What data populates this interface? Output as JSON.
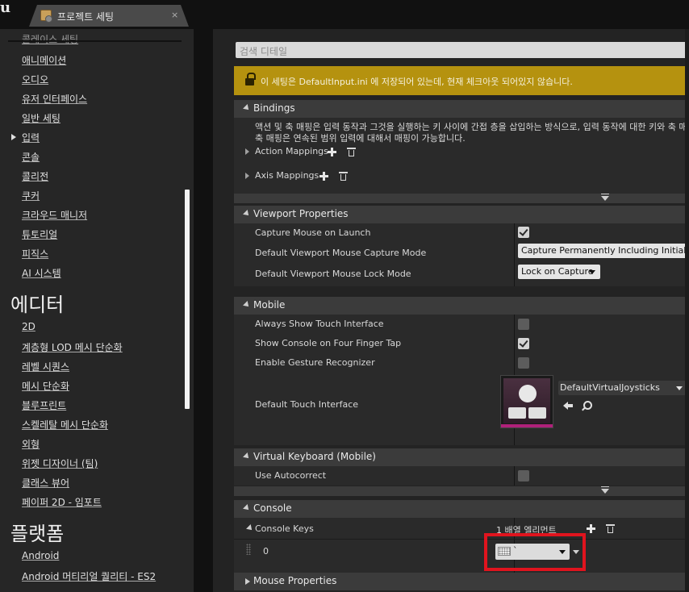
{
  "window": {
    "tab_title": "프로젝트 세팅",
    "close_glyph": "×",
    "logo_glyph": "u"
  },
  "sidebar": {
    "partial_top": "콜레이스 세팅",
    "items_engine": [
      {
        "label": "애니메이션"
      },
      {
        "label": "오디오"
      },
      {
        "label": "유저 인터페이스"
      },
      {
        "label": "일반 세팅"
      },
      {
        "label": "입력",
        "active": true
      },
      {
        "label": "콘솔"
      },
      {
        "label": "콜리전"
      },
      {
        "label": "쿠커"
      },
      {
        "label": "크라우드 매니저"
      },
      {
        "label": "튜토리얼"
      },
      {
        "label": "피직스"
      },
      {
        "label": "AI 시스템"
      }
    ],
    "heading_editor": "에디터",
    "items_editor": [
      {
        "label": "2D"
      },
      {
        "label": "계층형 LOD 메시 단순화"
      },
      {
        "label": "레벨 시퀀스"
      },
      {
        "label": "메시 단순화"
      },
      {
        "label": "블루프린트"
      },
      {
        "label": "스켈레탈 메시 단순화"
      },
      {
        "label": "외형"
      },
      {
        "label": "위젯 디자이너 (팀)"
      },
      {
        "label": "클래스 뷰어"
      },
      {
        "label": "페이퍼 2D - 임포트"
      }
    ],
    "heading_platform": "플랫폼",
    "items_platform": [
      {
        "label": "Android"
      },
      {
        "label": "Android 머티리얼 퀄리티 - ES2"
      }
    ]
  },
  "search": {
    "placeholder": "검색 디테일"
  },
  "warning": {
    "text": "이 세팅은 DefaultInput.ini 에 저장되어 있는데, 현재 체크아웃 되어있지 않습니다."
  },
  "bindings": {
    "title": "Bindings",
    "description_line1": "액션 및 축 매핑은 입력 동작과 그것을 실행하는 키 사이에 간접 층을 삽입하는 방식으로, 입력 동작에 대한 키와 축 매핑을",
    "description_line2": "축 매핑은 연속된 범위 입력에 대해서 매핑이 가능합니다.",
    "action_mappings": "Action Mappings",
    "axis_mappings": "Axis Mappings"
  },
  "viewport": {
    "title": "Viewport Properties",
    "capture_mouse_label": "Capture Mouse on Launch",
    "capture_mouse_checked": true,
    "capture_mode_label": "Default Viewport Mouse Capture Mode",
    "capture_mode_value": "Capture Permanently Including Initial Mouse Down",
    "lock_mode_label": "Default Viewport Mouse Lock Mode",
    "lock_mode_value": "Lock on Capture"
  },
  "mobile": {
    "title": "Mobile",
    "always_show_touch_label": "Always Show Touch Interface",
    "always_show_touch_checked": false,
    "show_console_label": "Show Console on Four Finger Tap",
    "show_console_checked": true,
    "gesture_label": "Enable Gesture Recognizer",
    "gesture_checked": false,
    "default_touch_label": "Default Touch Interface",
    "default_touch_value": "DefaultVirtualJoysticks"
  },
  "virtual_keyboard": {
    "title": "Virtual Keyboard (Mobile)",
    "autocorrect_label": "Use Autocorrect",
    "autocorrect_checked": false
  },
  "console": {
    "title": "Console",
    "keys_label": "Console Keys",
    "keys_count": "1 배열 엘리먼트",
    "element_index": "0",
    "key_value": "`"
  },
  "mouse": {
    "title": "Mouse Properties"
  },
  "colors": {
    "warning_bg": "#b5920f",
    "highlight": "#e0141e",
    "section_header": "#3b3b3b",
    "row_bg": "#2a2a2a"
  }
}
